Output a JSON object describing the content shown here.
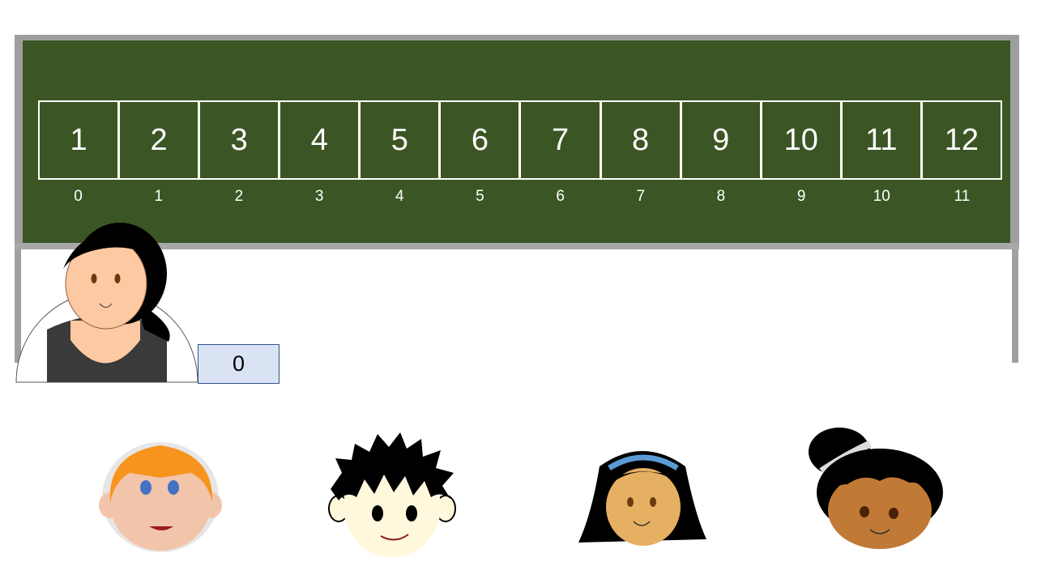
{
  "board": {
    "cells": [
      "1",
      "2",
      "3",
      "4",
      "5",
      "6",
      "7",
      "8",
      "9",
      "10",
      "11",
      "12"
    ],
    "indices": [
      "0",
      "1",
      "2",
      "3",
      "4",
      "5",
      "6",
      "7",
      "8",
      "9",
      "10",
      "11"
    ]
  },
  "counter": {
    "value": "0"
  },
  "figures": {
    "teacher": "teacher-figure",
    "students": [
      "student-orange-hair-boy",
      "student-spiky-hair-boy",
      "student-headband-girl",
      "student-bun-girl"
    ]
  }
}
